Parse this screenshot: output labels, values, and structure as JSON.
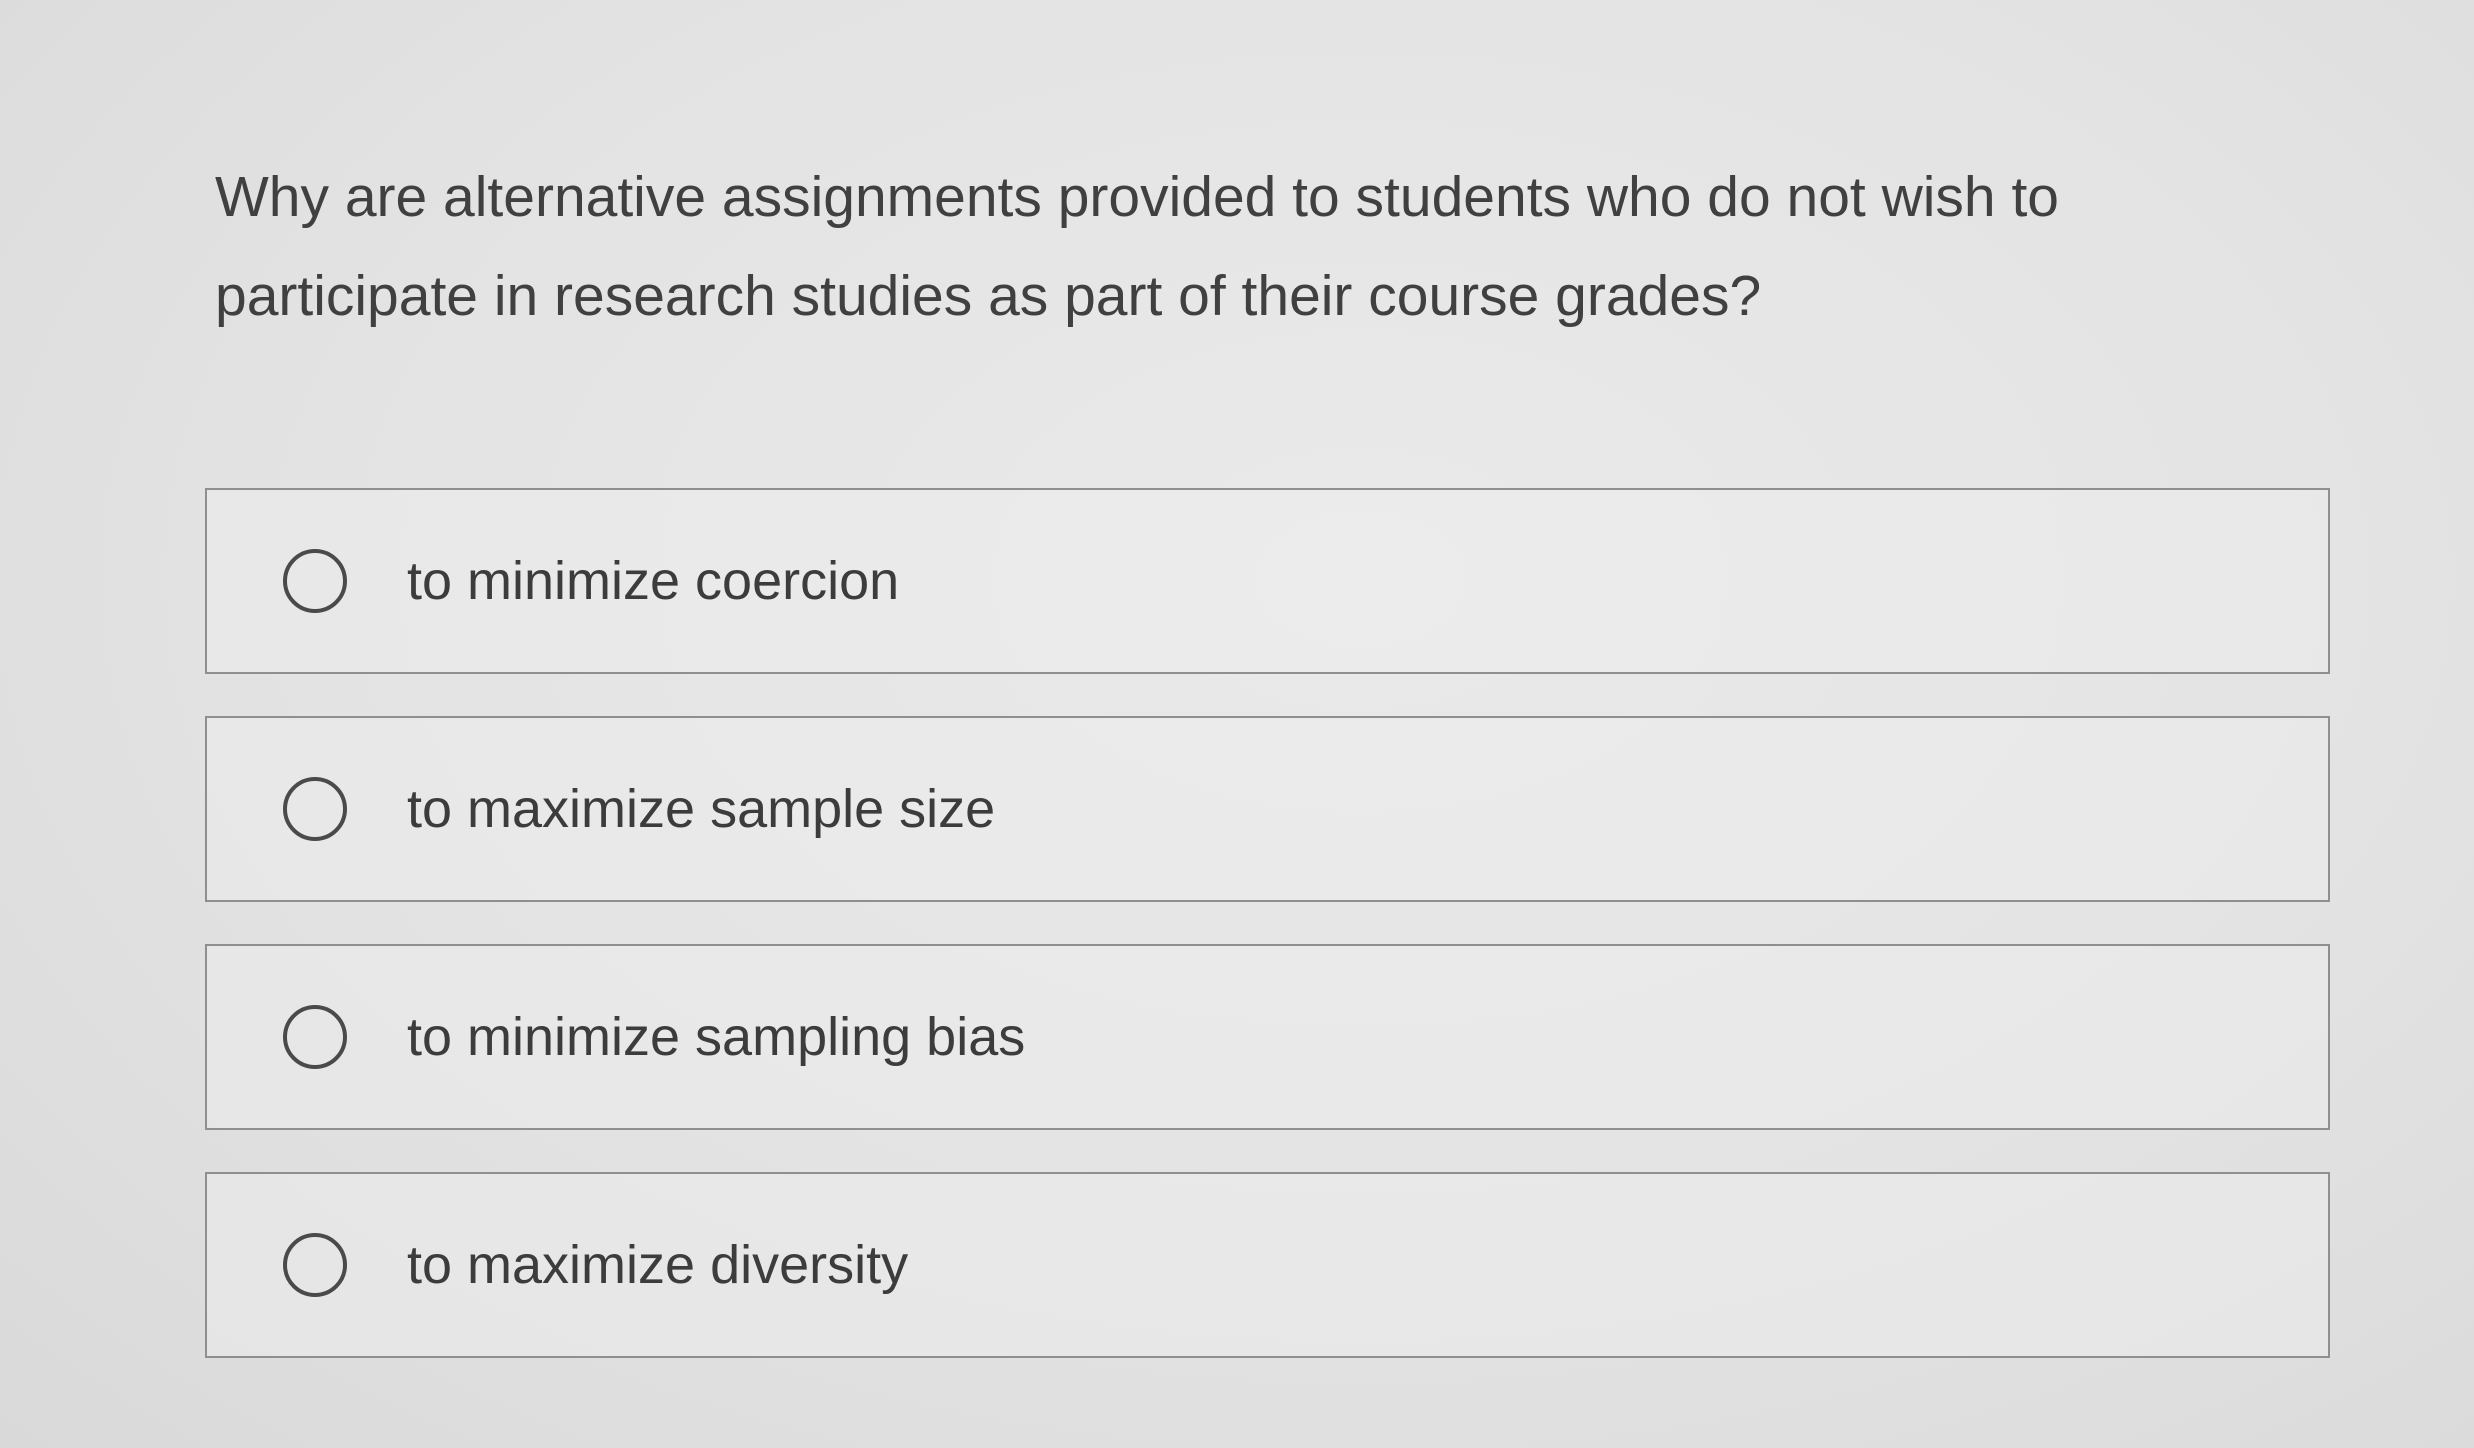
{
  "question": {
    "text": "Why are alternative assignments provided to students who do not wish to participate in research studies as part of their course grades?"
  },
  "options": [
    {
      "label": "to minimize coercion",
      "selected": false
    },
    {
      "label": "to maximize sample size",
      "selected": false
    },
    {
      "label": "to minimize sampling bias",
      "selected": false
    },
    {
      "label": "to maximize diversity",
      "selected": false
    }
  ]
}
